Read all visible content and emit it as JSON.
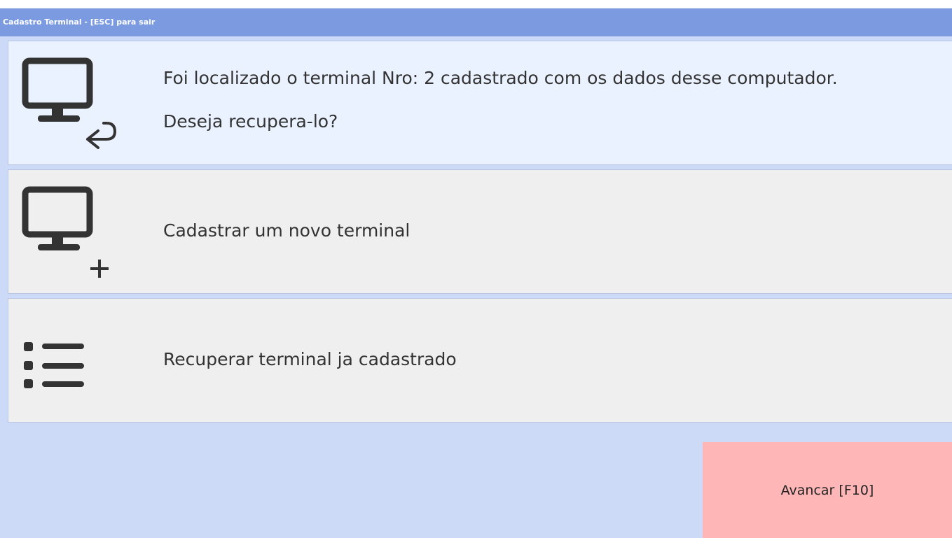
{
  "window": {
    "title": "Cadastro Terminal - [ESC] para sair"
  },
  "options": [
    {
      "lines": [
        "Foi localizado o terminal Nro: 2 cadastrado com os dados desse computador.",
        "Deseja recupera-lo?"
      ],
      "icon": "monitor-undo-icon",
      "selected": true
    },
    {
      "lines": [
        "Cadastrar um novo terminal"
      ],
      "icon": "monitor-add-icon",
      "selected": false
    },
    {
      "lines": [
        "Recuperar terminal ja cadastrado"
      ],
      "icon": "list-icon",
      "selected": false
    }
  ],
  "footer": {
    "advance_label": "Avancar [F10]"
  },
  "colors": {
    "titlebar": "#7b9ae0",
    "background": "#ccdaf7",
    "selected_option": "#eaf2ff",
    "option": "#efefef",
    "advance_button": "#ffb6b6",
    "icon": "#333333"
  }
}
